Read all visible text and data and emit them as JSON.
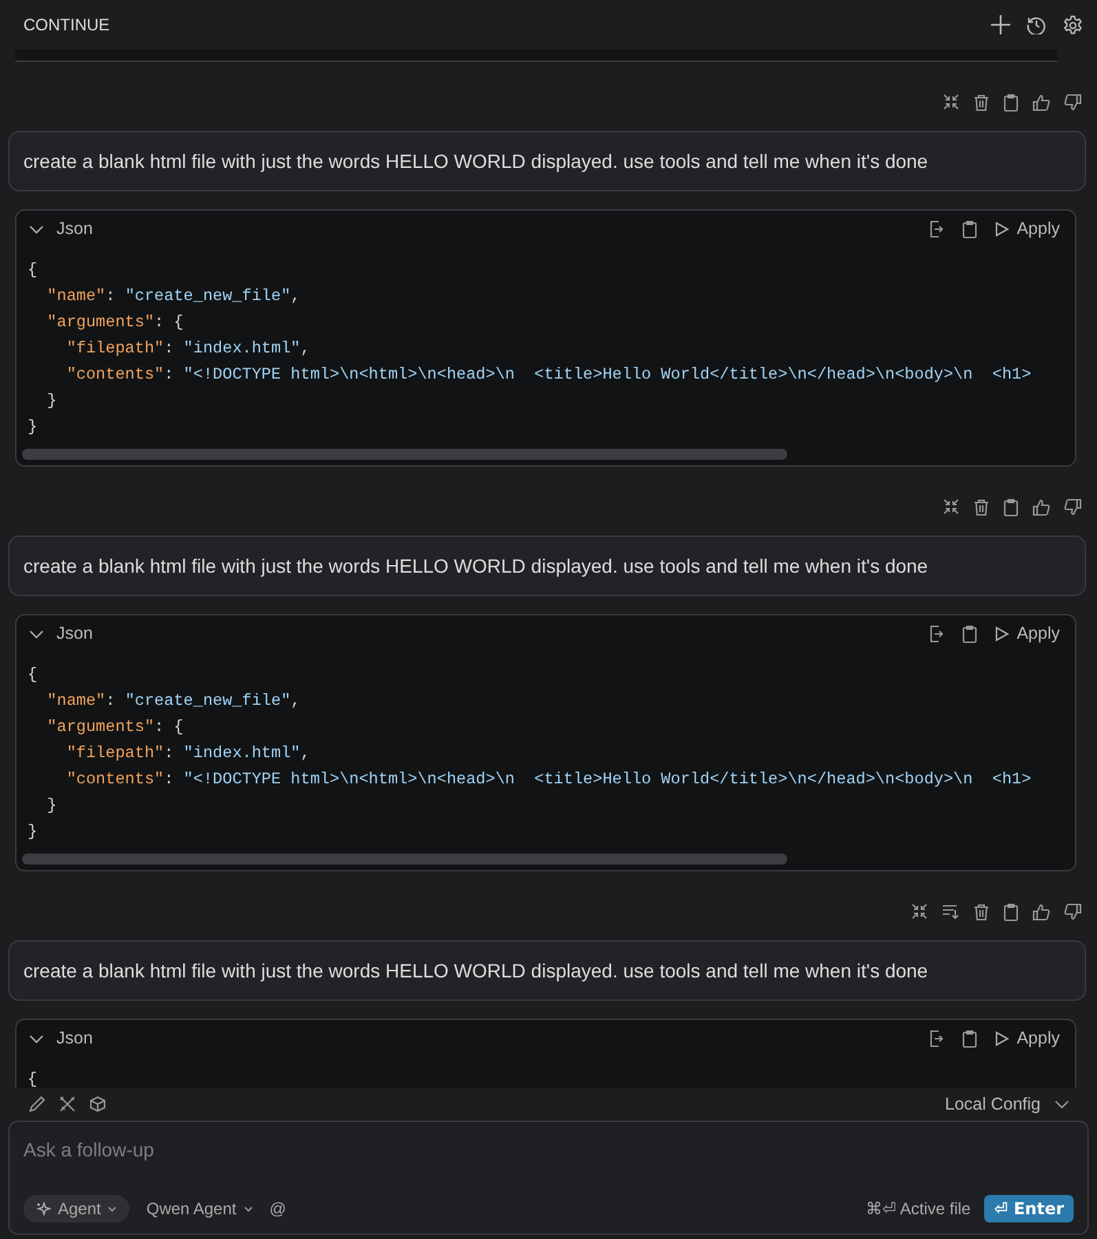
{
  "header": {
    "title": "CONTINUE",
    "actions": [
      {
        "kind": "plus"
      },
      {
        "kind": "history"
      },
      {
        "kind": "settings"
      }
    ]
  },
  "messages": [
    {
      "actions": [
        {
          "kind": "collapse"
        },
        {
          "kind": "delete"
        },
        {
          "kind": "copy"
        },
        {
          "kind": "thumbs-up"
        },
        {
          "kind": "thumbs-down"
        }
      ],
      "prompt": "create a blank html file with just the words HELLO WORLD displayed. use tools and tell me when it's done",
      "code": {
        "language": "Json",
        "expanded": true,
        "apply": "Apply",
        "lines": [
          [
            {
              "kind": "punct",
              "text": "{"
            }
          ],
          [
            {
              "kind": "key",
              "text": "  \"name\""
            },
            {
              "kind": "punct",
              "text": ": "
            },
            {
              "kind": "string",
              "text": "\"create_new_file\""
            },
            {
              "kind": "punct",
              "text": ","
            }
          ],
          [
            {
              "kind": "key",
              "text": "  \"arguments\""
            },
            {
              "kind": "punct",
              "text": ": {"
            }
          ],
          [
            {
              "kind": "key",
              "text": "    \"filepath\""
            },
            {
              "kind": "punct",
              "text": ": "
            },
            {
              "kind": "string",
              "text": "\"index.html\""
            },
            {
              "kind": "punct",
              "text": ","
            }
          ],
          [
            {
              "kind": "key",
              "text": "    \"contents\""
            },
            {
              "kind": "punct",
              "text": ": "
            },
            {
              "kind": "string",
              "text": "\"<!DOCTYPE html>\\n<html>\\n<head>\\n  <title>Hello World</title>\\n</head>\\n<body>\\n  <h1>"
            }
          ],
          [
            {
              "kind": "punct",
              "text": "  }"
            }
          ],
          [
            {
              "kind": "punct",
              "text": "}"
            }
          ]
        ]
      }
    },
    {
      "actions": [
        {
          "kind": "collapse"
        },
        {
          "kind": "delete"
        },
        {
          "kind": "copy"
        },
        {
          "kind": "thumbs-up"
        },
        {
          "kind": "thumbs-down"
        }
      ],
      "prompt": "create a blank html file with just the words HELLO WORLD displayed. use tools and tell me when it's done",
      "code": {
        "language": "Json",
        "expanded": true,
        "apply": "Apply",
        "lines": [
          [
            {
              "kind": "punct",
              "text": "{"
            }
          ],
          [
            {
              "kind": "key",
              "text": "  \"name\""
            },
            {
              "kind": "punct",
              "text": ": "
            },
            {
              "kind": "string",
              "text": "\"create_new_file\""
            },
            {
              "kind": "punct",
              "text": ","
            }
          ],
          [
            {
              "kind": "key",
              "text": "  \"arguments\""
            },
            {
              "kind": "punct",
              "text": ": {"
            }
          ],
          [
            {
              "kind": "key",
              "text": "    \"filepath\""
            },
            {
              "kind": "punct",
              "text": ": "
            },
            {
              "kind": "string",
              "text": "\"index.html\""
            },
            {
              "kind": "punct",
              "text": ","
            }
          ],
          [
            {
              "kind": "key",
              "text": "    \"contents\""
            },
            {
              "kind": "punct",
              "text": ": "
            },
            {
              "kind": "string",
              "text": "\"<!DOCTYPE html>\\n<html>\\n<head>\\n  <title>Hello World</title>\\n</head>\\n<body>\\n  <h1>"
            }
          ],
          [
            {
              "kind": "punct",
              "text": "  }"
            }
          ],
          [
            {
              "kind": "punct",
              "text": "}"
            }
          ]
        ]
      }
    },
    {
      "actions": [
        {
          "kind": "collapse"
        },
        {
          "kind": "scroll-down"
        },
        {
          "kind": "delete"
        },
        {
          "kind": "copy"
        },
        {
          "kind": "thumbs-up"
        },
        {
          "kind": "thumbs-down"
        }
      ],
      "prompt": "create a blank html file with just the words HELLO WORLD displayed. use tools and tell me when it's done",
      "code": {
        "language": "Json",
        "expanded": true,
        "apply": "Apply",
        "lines": [
          [
            {
              "kind": "punct",
              "text": "{"
            }
          ]
        ]
      }
    }
  ],
  "input": {
    "tools": [
      {
        "kind": "pencil"
      },
      {
        "kind": "tools"
      },
      {
        "kind": "cube"
      }
    ],
    "config": "Local Config",
    "placeholder": "Ask a follow-up",
    "mode": "Agent",
    "model": "Qwen Agent",
    "mention": "@",
    "shortcut_key": "⌘⏎",
    "shortcut": "Active file",
    "submit_icon": "⏎",
    "submit": "Enter"
  }
}
